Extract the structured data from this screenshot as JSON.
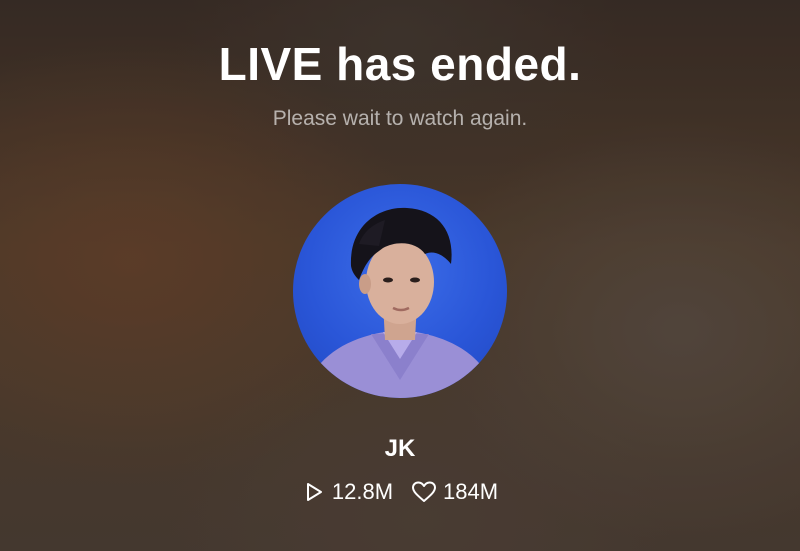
{
  "live": {
    "title": "LIVE has ended.",
    "subtitle": "Please wait to watch again."
  },
  "profile": {
    "name": "JK",
    "avatar_icon": "profile-photo",
    "avatar_background": "#2a56d8"
  },
  "stats": {
    "plays": {
      "icon": "play-icon",
      "value": "12.8M"
    },
    "likes": {
      "icon": "heart-icon",
      "value": "184M"
    }
  }
}
